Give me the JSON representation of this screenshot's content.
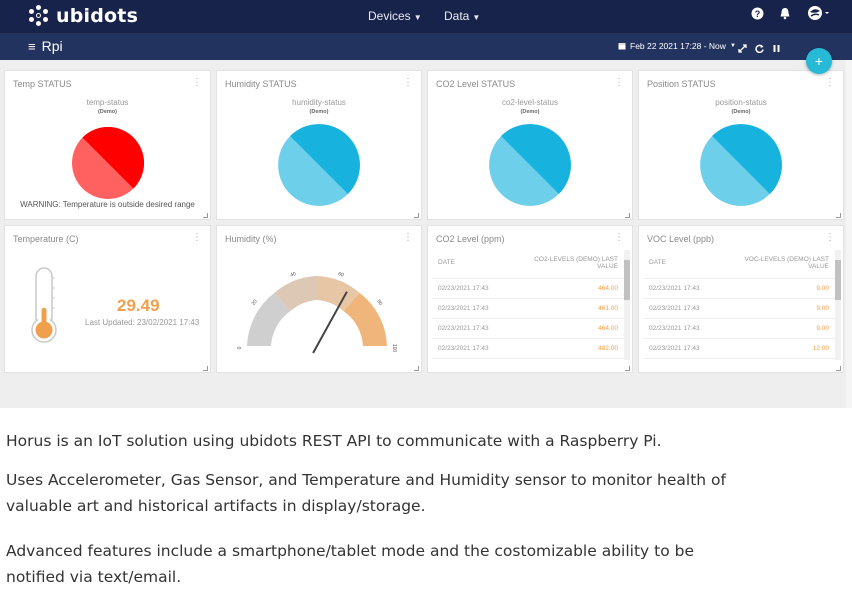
{
  "app": {
    "brand": "ubidots"
  },
  "nav": {
    "devices": "Devices",
    "data": "Data"
  },
  "header_icons": [
    "help-icon",
    "bell-icon",
    "user-avatar"
  ],
  "dashboard": {
    "title": "Rpi",
    "date_range": "Feb 22 2021 17:28 - Now",
    "add_label": "+"
  },
  "widgets": {
    "temp_status": {
      "title": "Temp STATUS",
      "variable": "temp-status",
      "device": "(Demo)",
      "warning": "WARNING: Temperature is outside desired range",
      "color": "#ff0000"
    },
    "humidity_status": {
      "title": "Humidity STATUS",
      "variable": "humidity-status",
      "device": "(Demo)",
      "color": "#17b2dd"
    },
    "co2_status": {
      "title": "CO2 Level STATUS",
      "variable": "co2-level-status",
      "device": "(Demo)",
      "color": "#17b2dd"
    },
    "position_status": {
      "title": "Position STATUS",
      "variable": "position-status",
      "device": "(Demo)",
      "color": "#17b2dd"
    },
    "temperature": {
      "title": "Temperature (C)",
      "value": "29.49",
      "updated": "Last Updated: 23/02/2021 17:43",
      "fill_fraction": 0.3
    },
    "humidity": {
      "title": "Humidity (%)",
      "ticks": [
        "0",
        "20",
        "40",
        "60",
        "80",
        "100"
      ],
      "needle_value": 66
    },
    "co2_table": {
      "title": "CO2 Level (ppm)",
      "col_date": "DATE",
      "col_value_1": "CO2-LEVELS (DEMO) LAST",
      "col_value_2": "VALUE",
      "rows": [
        {
          "date": "02/23/2021 17:43",
          "value": "464.00"
        },
        {
          "date": "02/23/2021 17:43",
          "value": "461.00"
        },
        {
          "date": "02/23/2021 17:43",
          "value": "464.00"
        },
        {
          "date": "02/23/2021 17:43",
          "value": "482.00"
        }
      ]
    },
    "voc_table": {
      "title": "VOC Level (ppb)",
      "col_date": "DATE",
      "col_value_1": "VOC-LEVELS (DEMO) LAST",
      "col_value_2": "VALUE",
      "rows": [
        {
          "date": "02/23/2021 17:43",
          "value": "9.00"
        },
        {
          "date": "02/23/2021 17:43",
          "value": "9.00"
        },
        {
          "date": "02/23/2021 17:43",
          "value": "9.00"
        },
        {
          "date": "02/23/2021 17:43",
          "value": "12.00"
        }
      ]
    }
  },
  "description": {
    "p1": "Horus is an IoT solution using ubidots REST API to communicate with a Raspberry Pi.",
    "p2a": "Uses Accelerometer, Gas Sensor, and Temperature and Humidity sensor to monitor health of",
    "p2b": "valuable art and historical artifacts in display/storage.",
    "p3a": "Advanced features include a smartphone/tablet mode and the costomizable ability to be",
    "p3b": "notified via text/email."
  }
}
